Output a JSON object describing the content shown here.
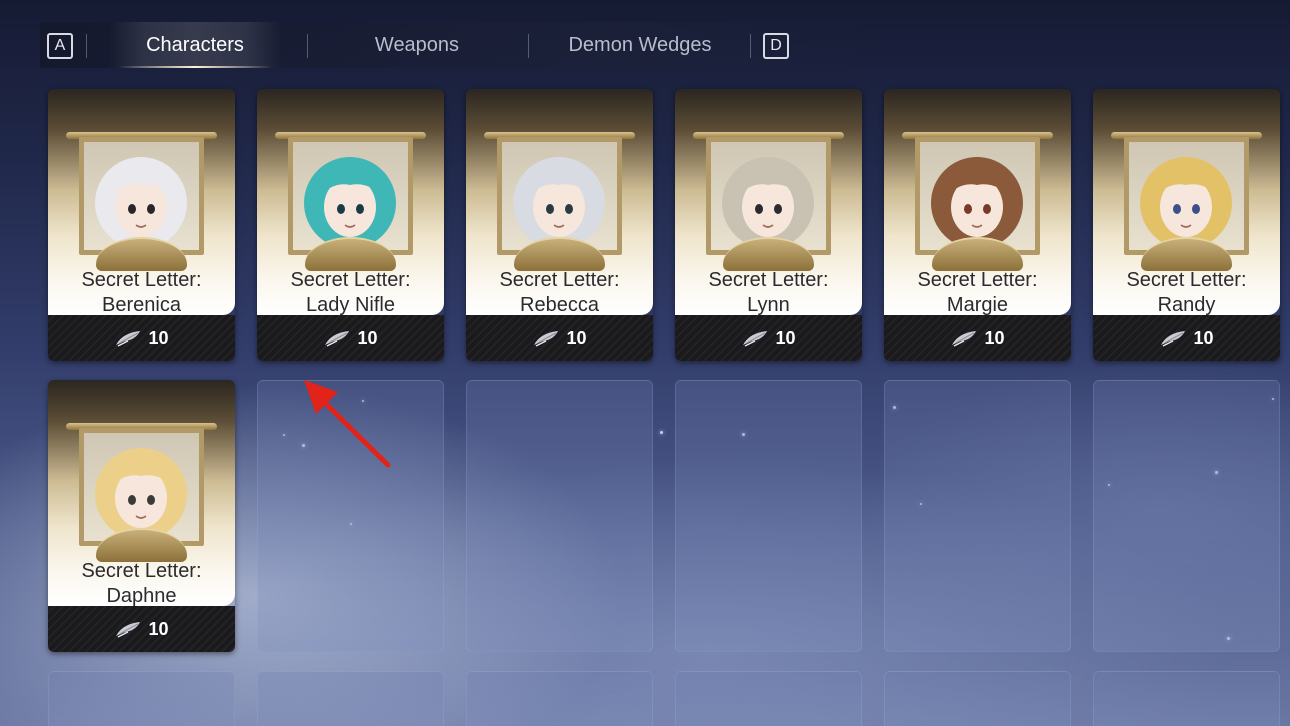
{
  "tabs": {
    "left_key": "A",
    "right_key": "D",
    "items": [
      {
        "label": "Characters",
        "active": true
      },
      {
        "label": "Weapons",
        "active": false
      },
      {
        "label": "Demon Wedges",
        "active": false
      }
    ]
  },
  "cards": [
    {
      "line1": "Secret Letter:",
      "line2": "Berenica",
      "cost": "10",
      "hair": "#e9e9ee",
      "accent": "#2a2528"
    },
    {
      "line1": "Secret Letter:",
      "line2": "Lady Nifle",
      "cost": "10",
      "hair": "#3fb7b7",
      "accent": "#1c3a44"
    },
    {
      "line1": "Secret Letter:",
      "line2": "Rebecca",
      "cost": "10",
      "hair": "#d8dbe2",
      "accent": "#2a3a44"
    },
    {
      "line1": "Secret Letter:",
      "line2": "Lynn",
      "cost": "10",
      "hair": "#c9c2b2",
      "accent": "#2c2a2e"
    },
    {
      "line1": "Secret Letter:",
      "line2": "Margie",
      "cost": "10",
      "hair": "#8a5a3a",
      "accent": "#7a3a2a"
    },
    {
      "line1": "Secret Letter:",
      "line2": "Randy",
      "cost": "10",
      "hair": "#e3c167",
      "accent": "#3b4f8a"
    },
    {
      "line1": "Secret Letter:",
      "line2": "Daphne",
      "cost": "10",
      "hair": "#ecd08a",
      "accent": "#3a3a3a"
    }
  ],
  "cost_icon": "quill-feather-icon",
  "annotation": {
    "color": "#e2231a",
    "icon": "red-arrow-annotation"
  }
}
